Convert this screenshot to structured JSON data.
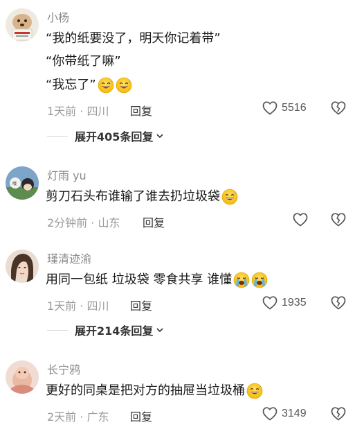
{
  "comments": [
    {
      "username": "小杨",
      "lines": [
        "“我的纸要没了，明天你记着带”",
        "“你带纸了嘛”",
        "“我忘了”"
      ],
      "emojis_line3": [
        "grinning-sweat-emoji",
        "grinning-sweat-emoji"
      ],
      "time": "1天前 · 四川",
      "reply_label": "回复",
      "likes": "5516",
      "expand_label": "展开405条回复"
    },
    {
      "username": "灯雨 yu",
      "lines": [
        "剪刀石头布谁输了谁去扔垃圾袋"
      ],
      "emojis_line1": [
        "grinning-sweat-emoji"
      ],
      "time": "2分钟前 · 山东",
      "reply_label": "回复",
      "likes": ""
    },
    {
      "username": "瑾清迹渝",
      "lines": [
        "用同一包纸 垃圾袋 零食共享 谁懂"
      ],
      "emojis_line1": [
        "crying-emoji",
        "crying-emoji"
      ],
      "time": "1天前 · 四川",
      "reply_label": "回复",
      "likes": "1935",
      "expand_label": "展开214条回复"
    },
    {
      "username": "长宁鸦",
      "lines": [
        "更好的同桌是把对方的抽屉当垃圾桶"
      ],
      "emojis_line1": [
        "grinning-sweat-emoji"
      ],
      "time": "2天前 · 广东",
      "reply_label": "回复",
      "likes": "3149"
    }
  ],
  "colors": {
    "username": "#8a8a8a",
    "text": "#1a1a1a",
    "meta": "#9a9a9a"
  }
}
